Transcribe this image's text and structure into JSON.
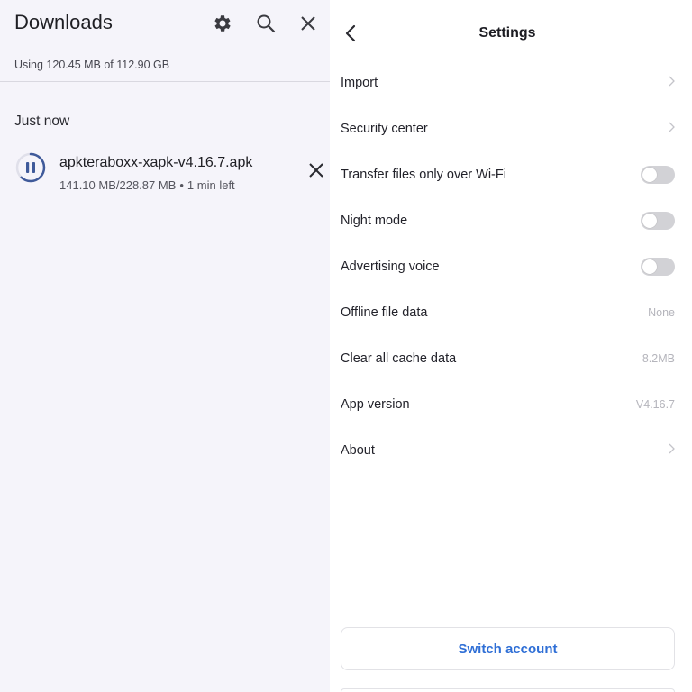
{
  "downloads": {
    "title": "Downloads",
    "usage": "Using 120.45 MB of 112.90 GB",
    "section": "Just now",
    "icons": [
      "gear-icon",
      "search-icon",
      "close-icon"
    ],
    "item": {
      "file_name": "apkteraboxx-xapk-v4.16.7.apk",
      "size_progress": "141.10 MB/228.87 MB",
      "separator": "•",
      "time_left": "1 min left",
      "progress_fraction": 0.62,
      "icon": "pause-icon"
    }
  },
  "settings": {
    "title": "Settings",
    "rows": [
      {
        "label": "Import",
        "control": "chevron"
      },
      {
        "label": "Security center",
        "control": "chevron"
      },
      {
        "label": "Transfer files only over Wi-Fi",
        "control": "toggle",
        "on": false
      },
      {
        "label": "Night mode",
        "control": "toggle",
        "on": false
      },
      {
        "label": "Advertising voice",
        "control": "toggle",
        "on": false
      },
      {
        "label": "Offline file data",
        "control": "value",
        "value": "None"
      },
      {
        "label": "Clear all cache data",
        "control": "value",
        "value": "8.2MB"
      },
      {
        "label": "App version",
        "control": "value",
        "value": "V4.16.7"
      },
      {
        "label": "About",
        "control": "chevron"
      }
    ],
    "switch_account": "Switch account"
  },
  "colors": {
    "accent": "#2f6fd6",
    "progress": "#3f5a9a",
    "left_bg": "#f5f4fa"
  }
}
